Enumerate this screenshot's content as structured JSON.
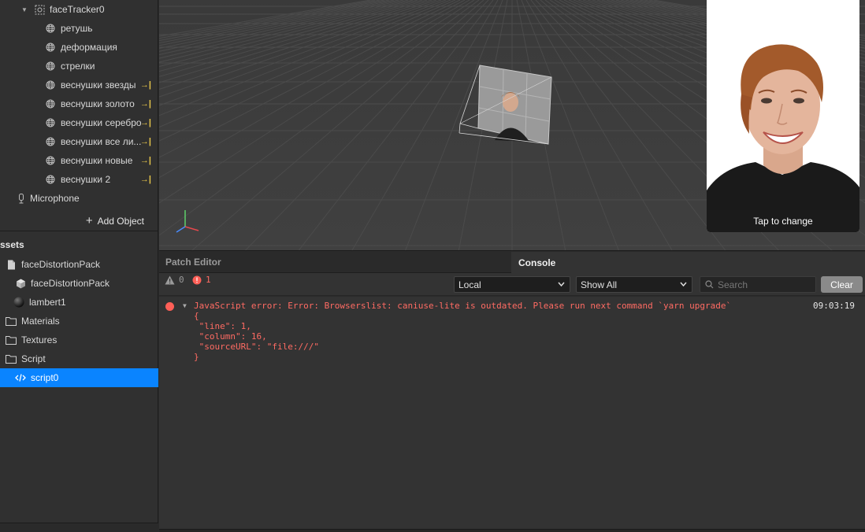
{
  "scene": {
    "tracker": {
      "label": "faceTracker0"
    },
    "items": [
      {
        "label": "ретушь",
        "linked": false
      },
      {
        "label": "деформация",
        "linked": false
      },
      {
        "label": "стрелки",
        "linked": false
      },
      {
        "label": "веснушки звезды",
        "linked": true
      },
      {
        "label": "веснушки золото",
        "linked": true
      },
      {
        "label": "веснушки серебро",
        "linked": true
      },
      {
        "label": "веснушки все ли...",
        "linked": true
      },
      {
        "label": "веснушки новые",
        "linked": true
      },
      {
        "label": "веснушки 2",
        "linked": true
      }
    ],
    "microphone": "Microphone",
    "link_glyph": "→|",
    "add_object": "Add Object"
  },
  "assets": {
    "header": "ssets",
    "items": [
      {
        "label": "faceDistortionPack",
        "icon": "file-icon"
      },
      {
        "label": "faceDistortionPack",
        "icon": "cube-icon"
      },
      {
        "label": "lambert1",
        "icon": "material-sphere-icon"
      },
      {
        "label": "Materials",
        "icon": "folder-icon"
      },
      {
        "label": "Textures",
        "icon": "folder-icon"
      },
      {
        "label": "Script",
        "icon": "folder-icon"
      },
      {
        "label": "script0",
        "icon": "code-icon",
        "selected": true
      }
    ]
  },
  "simulator": {
    "tap_label": "Tap to change"
  },
  "tabs": {
    "patch_editor": "Patch Editor",
    "console": "Console"
  },
  "toolbar": {
    "warnings": "0",
    "errors": "1",
    "scope": "Local",
    "filter": "Show All",
    "search_placeholder": "Search",
    "clear": "Clear"
  },
  "console": {
    "message": "JavaScript error: Error: Browserslist: caniuse-lite is outdated. Please run next command `yarn upgrade`",
    "details": "{\n \"line\": 1,\n \"column\": 16,\n \"sourceURL\": \"file:///\"\n}",
    "time": "09:03:19"
  },
  "colors": {
    "accent": "#0a84ff",
    "error": "#ff5f57",
    "link": "#e8c64a"
  }
}
